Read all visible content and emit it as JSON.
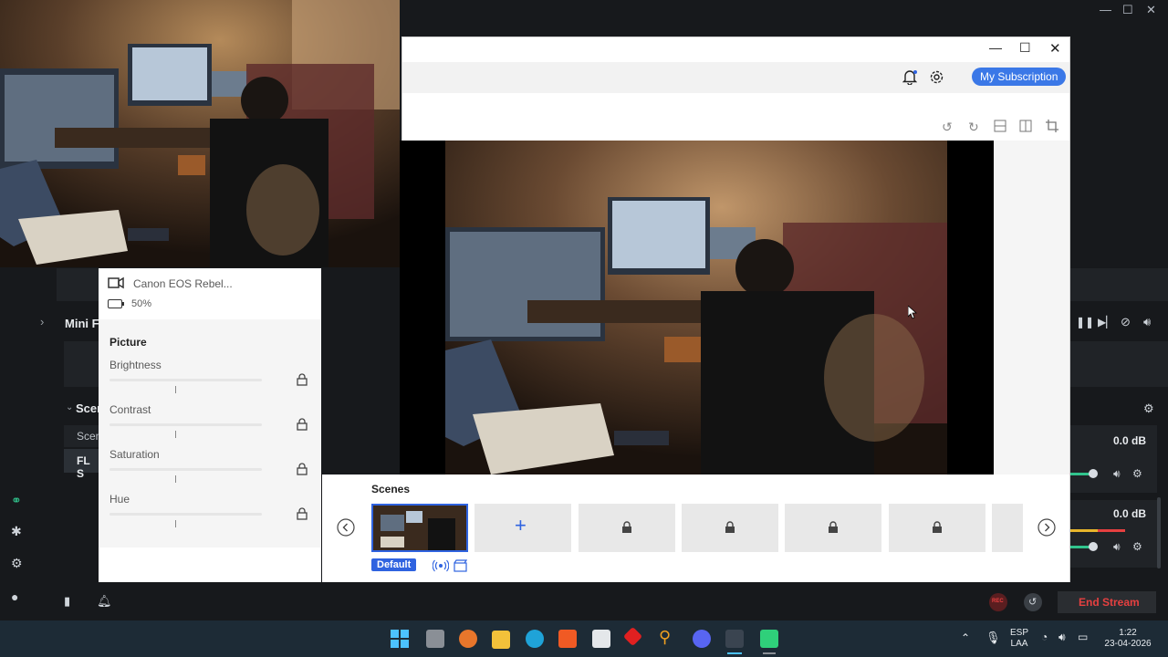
{
  "background_app": {
    "window_controls": {
      "minimize": "—",
      "maximize": "☐",
      "close": "✕"
    },
    "mini_feed_label": "Mini F",
    "scenes_section_label": "Scen",
    "scene_item_1": "Scen",
    "scene_item_2": "FL S",
    "audio": {
      "mixer_1_db": "0.0 dB",
      "mixer_2_db": "0.0 dB"
    },
    "end_stream_label": "End Stream",
    "rec_label": "REC"
  },
  "side_panel": {
    "camera_name": "Canon EOS Rebel...",
    "battery_level": "50%",
    "section_title": "Picture",
    "settings": [
      {
        "label": "Brightness",
        "value": 0.5
      },
      {
        "label": "Contrast",
        "value": 0.5
      },
      {
        "label": "Saturation",
        "value": 0.5
      },
      {
        "label": "Hue",
        "value": 0.5
      }
    ]
  },
  "dialog": {
    "subscription_button": "My Subscription",
    "window_controls": {
      "minimize": "—",
      "maximize": "☐",
      "close": "✕"
    },
    "scenes_title": "Scenes",
    "default_scene_label": "Default",
    "add_scene_symbol": "+"
  },
  "taskbar": {
    "language_top": "ESP",
    "language_bottom": "LAA",
    "time": "1:22",
    "date": "23-04-2026"
  },
  "colors": {
    "accent": "#2f63e0",
    "subscription_button": "#3b78e7",
    "end_stream": "#e64040"
  }
}
